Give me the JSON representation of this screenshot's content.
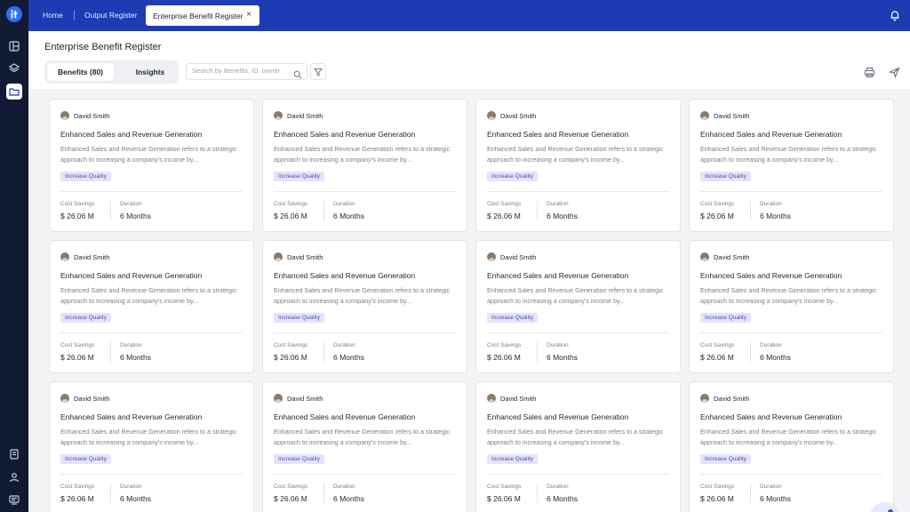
{
  "topbar": {
    "breadcrumbs": [
      "Home",
      "Output Register"
    ],
    "active_tab": "Enterprise Benefit Register",
    "close_glyph": "×"
  },
  "icons": {
    "logo": "logo-icon",
    "rail": [
      "dashboard-icon",
      "layers-icon",
      "folder-icon",
      "document-icon",
      "user-icon",
      "support-icon"
    ],
    "bell": "bell-icon",
    "search": "search-icon",
    "filter": "filter-icon",
    "print": "print-icon",
    "send": "send-icon"
  },
  "header": {
    "title": "Enterprise Benefit Register",
    "tabs": [
      "Benefits (80)",
      "Insights"
    ],
    "search_placeholder": "Search by Benefits, ID, owner"
  },
  "colors": {
    "topbar": "#1e3bb3",
    "rail": "#111a33",
    "accent": "#2f6bff",
    "tag_bg": "#e4e3fb",
    "tag_text": "#4a4fb0"
  },
  "cards": [
    {
      "owner": "David Smith",
      "title": "Enhanced Sales and Revenue Generation",
      "desc": "Enhanced Sales and Revenue Generation refers to a strategic approach to increasing a company's income by...",
      "tag": "Increase Quality",
      "savings_label": "Cost Savings",
      "savings": "$ 26.06 M",
      "duration_label": "Duration",
      "duration": "6 Months"
    },
    {
      "owner": "David Smith",
      "title": "Enhanced Sales and Revenue Generation",
      "desc": "Enhanced Sales and Revenue Generation refers to a strategic approach to increasing a company's income by...",
      "tag": "Increase Quality",
      "savings_label": "Cost Savings",
      "savings": "$ 26.06 M",
      "duration_label": "Duration",
      "duration": "6 Months"
    },
    {
      "owner": "David Smith",
      "title": "Enhanced Sales and Revenue Generation",
      "desc": "Enhanced Sales and Revenue Generation refers to a strategic approach to increasing a company's income by...",
      "tag": "Increase Quality",
      "savings_label": "Cost Savings",
      "savings": "$ 26.06 M",
      "duration_label": "Duration",
      "duration": "6 Months"
    },
    {
      "owner": "David Smith",
      "title": "Enhanced Sales and Revenue Generation",
      "desc": "Enhanced Sales and Revenue Generation refers to a strategic approach to increasing a company's income by...",
      "tag": "Increase Quality",
      "savings_label": "Cost Savings",
      "savings": "$ 26.06 M",
      "duration_label": "Duration",
      "duration": "6 Months"
    },
    {
      "owner": "David Smith",
      "title": "Enhanced Sales and Revenue Generation",
      "desc": "Enhanced Sales and Revenue Generation refers to a strategic approach to increasing a company's income by...",
      "tag": "Increase Quality",
      "savings_label": "Cost Savings",
      "savings": "$ 26.06 M",
      "duration_label": "Duration",
      "duration": "6 Months"
    },
    {
      "owner": "David Smith",
      "title": "Enhanced Sales and Revenue Generation",
      "desc": "Enhanced Sales and Revenue Generation refers to a strategic approach to increasing a company's income by...",
      "tag": "Increase Quality",
      "savings_label": "Cost Savings",
      "savings": "$ 26.06 M",
      "duration_label": "Duration",
      "duration": "6 Months"
    },
    {
      "owner": "David Smith",
      "title": "Enhanced Sales and Revenue Generation",
      "desc": "Enhanced Sales and Revenue Generation refers to a strategic approach to increasing a company's income by...",
      "tag": "Increase Quality",
      "savings_label": "Cost Savings",
      "savings": "$ 26.06 M",
      "duration_label": "Duration",
      "duration": "6 Months"
    },
    {
      "owner": "David Smith",
      "title": "Enhanced Sales and Revenue Generation",
      "desc": "Enhanced Sales and Revenue Generation refers to a strategic approach to increasing a company's income by...",
      "tag": "Increase Quality",
      "savings_label": "Cost Savings",
      "savings": "$ 26.06 M",
      "duration_label": "Duration",
      "duration": "6 Months"
    },
    {
      "owner": "David Smith",
      "title": "Enhanced Sales and Revenue Generation",
      "desc": "Enhanced Sales and Revenue Generation refers to a strategic approach to increasing a company's income by...",
      "tag": "Increase Quality",
      "savings_label": "Cost Savings",
      "savings": "$ 26.06 M",
      "duration_label": "Duration",
      "duration": "6 Months"
    },
    {
      "owner": "David Smith",
      "title": "Enhanced Sales and Revenue Generation",
      "desc": "Enhanced Sales and Revenue Generation refers to a strategic approach to increasing a company's income by...",
      "tag": "Increase Quality",
      "savings_label": "Cost Savings",
      "savings": "$ 26.06 M",
      "duration_label": "Duration",
      "duration": "6 Months"
    },
    {
      "owner": "David Smith",
      "title": "Enhanced Sales and Revenue Generation",
      "desc": "Enhanced Sales and Revenue Generation refers to a strategic approach to increasing a company's income by...",
      "tag": "Increase Quality",
      "savings_label": "Cost Savings",
      "savings": "$ 26.06 M",
      "duration_label": "Duration",
      "duration": "6 Months"
    },
    {
      "owner": "David Smith",
      "title": "Enhanced Sales and Revenue Generation",
      "desc": "Enhanced Sales and Revenue Generation refers to a strategic approach to increasing a company's income by...",
      "tag": "Increase Quality",
      "savings_label": "Cost Savings",
      "savings": "$ 26.06 M",
      "duration_label": "Duration",
      "duration": "6 Months"
    }
  ]
}
